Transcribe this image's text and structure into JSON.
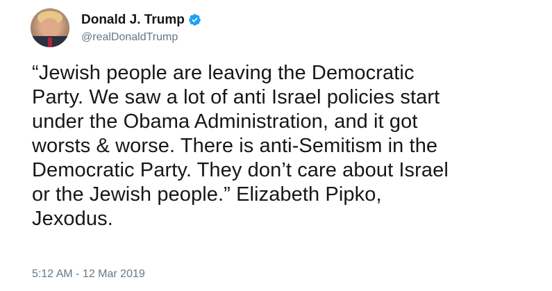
{
  "tweet": {
    "author": {
      "display_name": "Donald J. Trump",
      "handle": "@realDonaldTrump",
      "verified": true,
      "avatar_icon": "profile-photo"
    },
    "text": "“Jewish people are leaving the Democratic\nParty. We saw a lot of anti Israel policies start\nunder the Obama Administration, and it got\nworsts & worse. There is anti-Semitism in the\nDemocratic Party. They don’t care about Israel\nor the Jewish people.” Elizabeth Pipko,\nJexodus.",
    "timestamp": "5:12 AM - 12 Mar 2019"
  },
  "colors": {
    "primary_text": "#14171a",
    "secondary_text": "#657786",
    "verified_badge": "#1da1f2",
    "background": "#ffffff"
  }
}
